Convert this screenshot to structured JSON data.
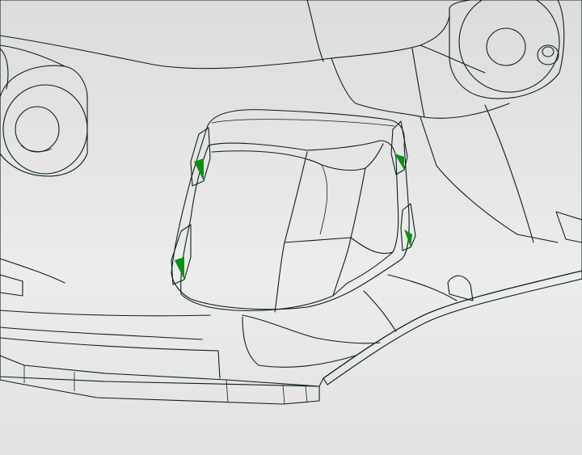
{
  "viewport": {
    "background_color": "#e4e4e4"
  },
  "model": {
    "base_color": "#4fe9df",
    "shade_color": "#2fd2c8",
    "highlight_color": "#86f7ef",
    "edge_color": "#0b1e1e",
    "selection_color": "#18c81a",
    "selection_dark_color": "#0e8f12"
  },
  "features": {
    "selected_face": "green-selected-face",
    "bosses": [
      "left-boss",
      "right-boss",
      "small-pin"
    ],
    "clips": [
      "clip-top-left",
      "clip-bottom-left",
      "clip-top-right",
      "clip-bottom-right"
    ]
  }
}
